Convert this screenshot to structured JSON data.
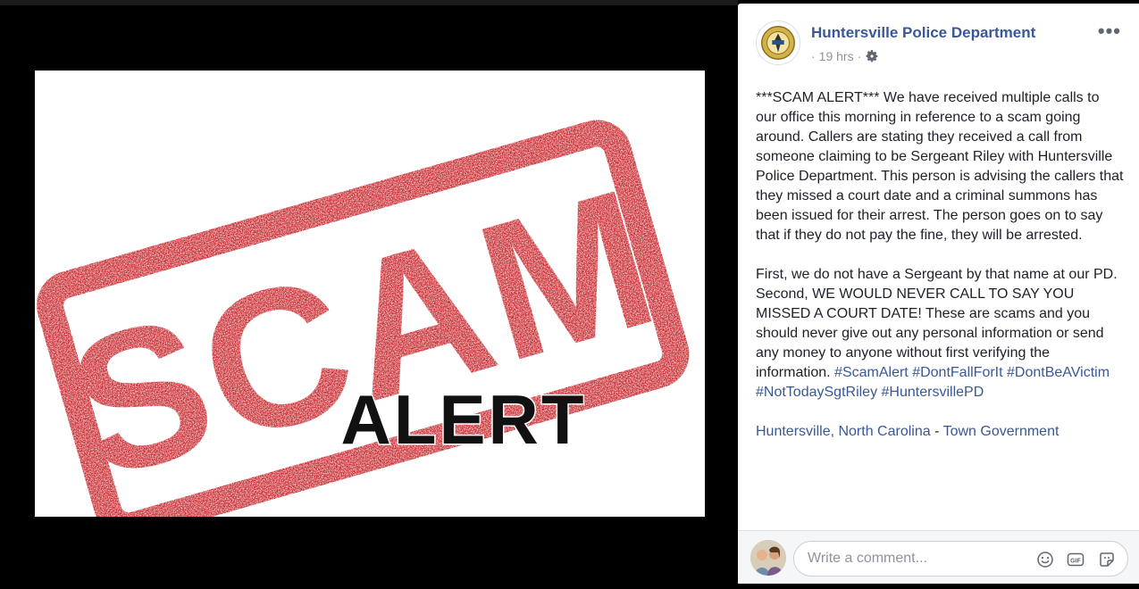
{
  "viewer": {
    "image": {
      "top_word": "SCAM",
      "bottom_word": "ALERT",
      "stamp_color": "#c4161c"
    }
  },
  "post": {
    "page_name": "Huntersville Police Department",
    "time": "19 hrs",
    "more_label": "•••",
    "paragraph1": "***SCAM ALERT*** We have received multiple calls to our office this morning in reference to a scam going around. Callers are stating they received a call from someone claiming to be Sergeant Riley with Huntersville Police Department. This person is advising the callers that they missed a court date and a criminal summons has been issued for their arrest. The person goes on to say that if they do not pay the fine, they will be arrested.",
    "paragraph2": "First, we do not have a Sergeant by that name at our PD. Second, WE WOULD NEVER CALL TO SAY YOU MISSED A COURT DATE! These are scams and you should never give out any personal information or send any money to anyone without first verifying the information.",
    "hashtags": [
      "#ScamAlert",
      "#DontFallForIt",
      "#DontBeAVictim",
      "#NotTodaySgtRiley",
      "#HuntersvillePD"
    ],
    "location": "Huntersville, North Carolina",
    "location_sep": " - ",
    "category": "Town Government",
    "link_color": "#385898"
  },
  "comment": {
    "placeholder": "Write a comment...",
    "icons": [
      "emoji-icon",
      "gif-icon",
      "sticker-icon"
    ]
  }
}
